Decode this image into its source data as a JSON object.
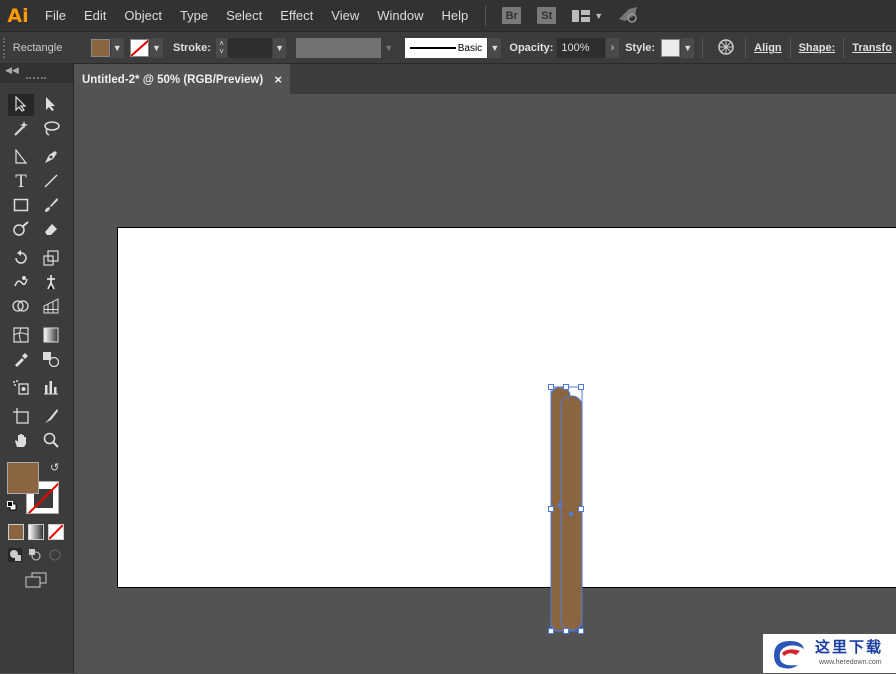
{
  "app": {
    "logo": "Ai",
    "window_title": "Untitled-2* @ 50% (RGB/Preview)"
  },
  "menu": [
    "File",
    "Edit",
    "Object",
    "Type",
    "Select",
    "Effect",
    "View",
    "Window",
    "Help"
  ],
  "app_buttons": {
    "bridge": "Br",
    "stock": "St"
  },
  "control_bar": {
    "object_type": "Rectangle",
    "stroke_label": "Stroke:",
    "stroke_profile": "Basic",
    "opacity_label": "Opacity:",
    "opacity_value": "100%",
    "style_label": "Style:",
    "align_label": "Align",
    "shape_label": "Shape:",
    "transform_label": "Transfo"
  },
  "colors": {
    "fill": "#8b6440",
    "selection": "#4f7bd4",
    "accent": "#ff9a00"
  },
  "icons": [
    "selection-icon",
    "direct-selection-icon",
    "magic-wand-icon",
    "lasso-icon",
    "pen-icon",
    "type-icon",
    "line-icon",
    "rectangle-icon",
    "paintbrush-icon",
    "shaper-icon",
    "eraser-icon",
    "rotate-icon",
    "scale-icon",
    "warp-icon",
    "free-transform-icon",
    "shape-builder-icon",
    "perspective-grid-icon",
    "mesh-icon",
    "gradient-icon",
    "eyedropper-icon",
    "blend-icon",
    "symbol-sprayer-icon",
    "graph-icon",
    "artboard-icon",
    "slice-icon",
    "hand-icon",
    "zoom-icon",
    "swap-icon",
    "default-colors-icon",
    "screen-mode-icon"
  ],
  "watermark": {
    "text": "这里下载",
    "url": "www.heredown.com"
  }
}
